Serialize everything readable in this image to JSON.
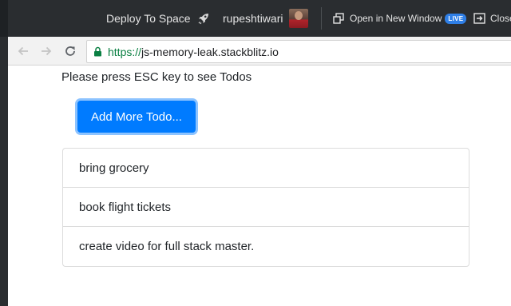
{
  "topbar": {
    "deploy_label": "Deploy To Space",
    "username": "rupeshtiwari",
    "open_window_label": "Open in New Window",
    "live_badge": "LIVE",
    "close_label": "Close"
  },
  "browser": {
    "url_scheme": "https://",
    "url_host": "js-memory-leak.stackblitz.io"
  },
  "page": {
    "hint": "Please press ESC key to see Todos",
    "add_button_label": "Add More Todo...",
    "todos": [
      "bring grocery",
      "book flight tickets",
      "create video for full stack master."
    ]
  },
  "colors": {
    "topbar_bg": "#2a2d30",
    "primary_button": "#007bff",
    "live_badge": "#2f7fe6",
    "secure_url": "#0b8043"
  },
  "icons": {
    "deploy": "rocket-icon",
    "open_window": "open-window-icon",
    "close": "close-panel-icon",
    "back": "back-arrow-icon",
    "forward": "forward-arrow-icon",
    "reload": "reload-icon",
    "lock": "lock-icon"
  }
}
